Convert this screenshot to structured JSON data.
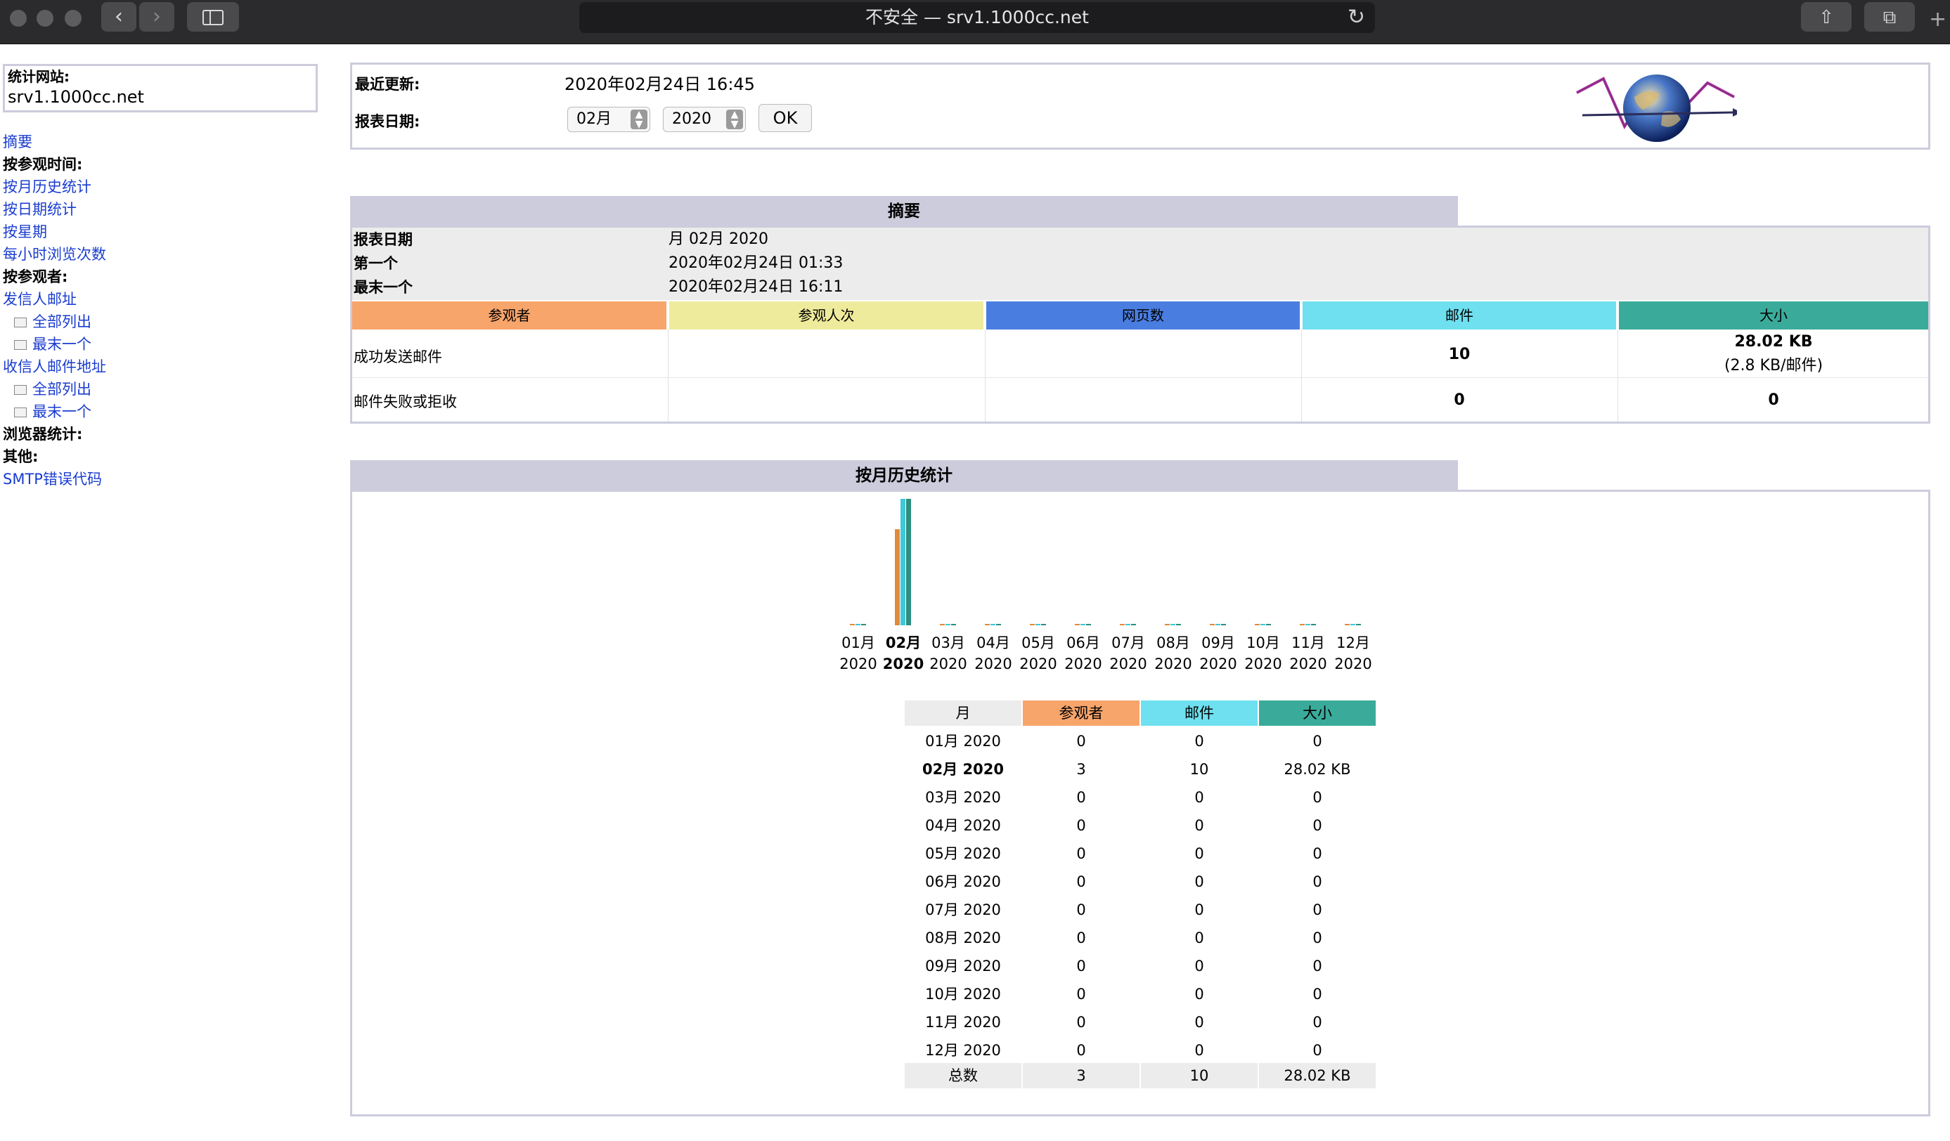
{
  "browser": {
    "url_text": "不安全 — srv1.1000cc.net",
    "back_icon": "chevron-left-icon",
    "forward_icon": "chevron-right-icon",
    "sidebar_icon": "sidebar-icon",
    "reload_icon": "reload-icon",
    "share_icon": "share-icon",
    "tabs_icon": "tabs-icon"
  },
  "sidebar": {
    "site_label": "统计网站:",
    "site_value": "srv1.1000cc.net",
    "items": [
      {
        "label": "摘要",
        "type": "link"
      },
      {
        "label": "按参观时间:",
        "type": "head"
      },
      {
        "label": "按月历史统计",
        "type": "link"
      },
      {
        "label": "按日期统计",
        "type": "link"
      },
      {
        "label": "按星期",
        "type": "link"
      },
      {
        "label": "每小时浏览次数",
        "type": "link"
      },
      {
        "label": "按参观者:",
        "type": "head"
      },
      {
        "label": "发信人邮址",
        "type": "link"
      },
      {
        "label": "全部列出",
        "type": "sub"
      },
      {
        "label": "最末一个",
        "type": "sub"
      },
      {
        "label": "收信人邮件地址",
        "type": "link"
      },
      {
        "label": "全部列出",
        "type": "sub"
      },
      {
        "label": "最末一个",
        "type": "sub"
      },
      {
        "label": "浏览器统计:",
        "type": "head"
      },
      {
        "label": "其他:",
        "type": "head"
      },
      {
        "label": "SMTP错误代码",
        "type": "link"
      }
    ]
  },
  "info": {
    "last_update_label": "最近更新:",
    "last_update_value": "2020年02月24日 16:45",
    "report_date_label": "报表日期:",
    "month_select": "02月",
    "year_select": "2020",
    "ok_label": "OK"
  },
  "summary": {
    "title": "摘要",
    "rows": [
      {
        "k": "报表日期",
        "v": "月 02月 2020"
      },
      {
        "k": "第一个",
        "v": "2020年02月24日 01:33"
      },
      {
        "k": "最末一个",
        "v": "2020年02月24日 16:11"
      }
    ],
    "columns": [
      "参观者",
      "参观人次",
      "网页数",
      "邮件",
      "大小"
    ],
    "column_colors": [
      "#f8a56b",
      "#efeb9c",
      "#4a7de0",
      "#6ee0ef",
      "#3aab9a"
    ],
    "success_label": "成功发送邮件",
    "success_mail": "10",
    "success_size": "28.02 KB",
    "success_size_sub": "(2.8 KB/邮件)",
    "fail_label": "邮件失败或拒收",
    "fail_mail": "0",
    "fail_size": "0"
  },
  "history": {
    "title": "按月历史统计",
    "table_headers": [
      "月",
      "参观者",
      "邮件",
      "大小"
    ],
    "rows": [
      {
        "month": "01月 2020",
        "visitors": "0",
        "mail": "0",
        "size": "0"
      },
      {
        "month": "02月 2020",
        "visitors": "3",
        "mail": "10",
        "size": "28.02 KB"
      },
      {
        "month": "03月 2020",
        "visitors": "0",
        "mail": "0",
        "size": "0"
      },
      {
        "month": "04月 2020",
        "visitors": "0",
        "mail": "0",
        "size": "0"
      },
      {
        "month": "05月 2020",
        "visitors": "0",
        "mail": "0",
        "size": "0"
      },
      {
        "month": "06月 2020",
        "visitors": "0",
        "mail": "0",
        "size": "0"
      },
      {
        "month": "07月 2020",
        "visitors": "0",
        "mail": "0",
        "size": "0"
      },
      {
        "month": "08月 2020",
        "visitors": "0",
        "mail": "0",
        "size": "0"
      },
      {
        "month": "09月 2020",
        "visitors": "0",
        "mail": "0",
        "size": "0"
      },
      {
        "month": "10月 2020",
        "visitors": "0",
        "mail": "0",
        "size": "0"
      },
      {
        "month": "11月 2020",
        "visitors": "0",
        "mail": "0",
        "size": "0"
      },
      {
        "month": "12月 2020",
        "visitors": "0",
        "mail": "0",
        "size": "0"
      }
    ],
    "total": {
      "label": "总数",
      "visitors": "3",
      "mail": "10",
      "size": "28.02 KB"
    }
  },
  "chart_data": {
    "type": "bar",
    "categories": [
      "01月 2020",
      "02月 2020",
      "03月 2020",
      "04月 2020",
      "05月 2020",
      "06月 2020",
      "07月 2020",
      "08月 2020",
      "09月 2020",
      "10月 2020",
      "11月 2020",
      "12月 2020"
    ],
    "category_months": [
      "01月",
      "02月",
      "03月",
      "04月",
      "05月",
      "06月",
      "07月",
      "08月",
      "09月",
      "10月",
      "11月",
      "12月"
    ],
    "category_years": [
      "2020",
      "2020",
      "2020",
      "2020",
      "2020",
      "2020",
      "2020",
      "2020",
      "2020",
      "2020",
      "2020",
      "2020"
    ],
    "highlight_index": 1,
    "series": [
      {
        "name": "参观者",
        "values": [
          0,
          3,
          0,
          0,
          0,
          0,
          0,
          0,
          0,
          0,
          0,
          0
        ],
        "color": "#e08a3a"
      },
      {
        "name": "邮件",
        "values": [
          0,
          10,
          0,
          0,
          0,
          0,
          0,
          0,
          0,
          0,
          0,
          0
        ],
        "color": "#40c8d8"
      },
      {
        "name": "大小",
        "values": [
          0,
          28.02,
          0,
          0,
          0,
          0,
          0,
          0,
          0,
          0,
          0,
          0
        ],
        "color": "#2a8f80"
      }
    ]
  }
}
